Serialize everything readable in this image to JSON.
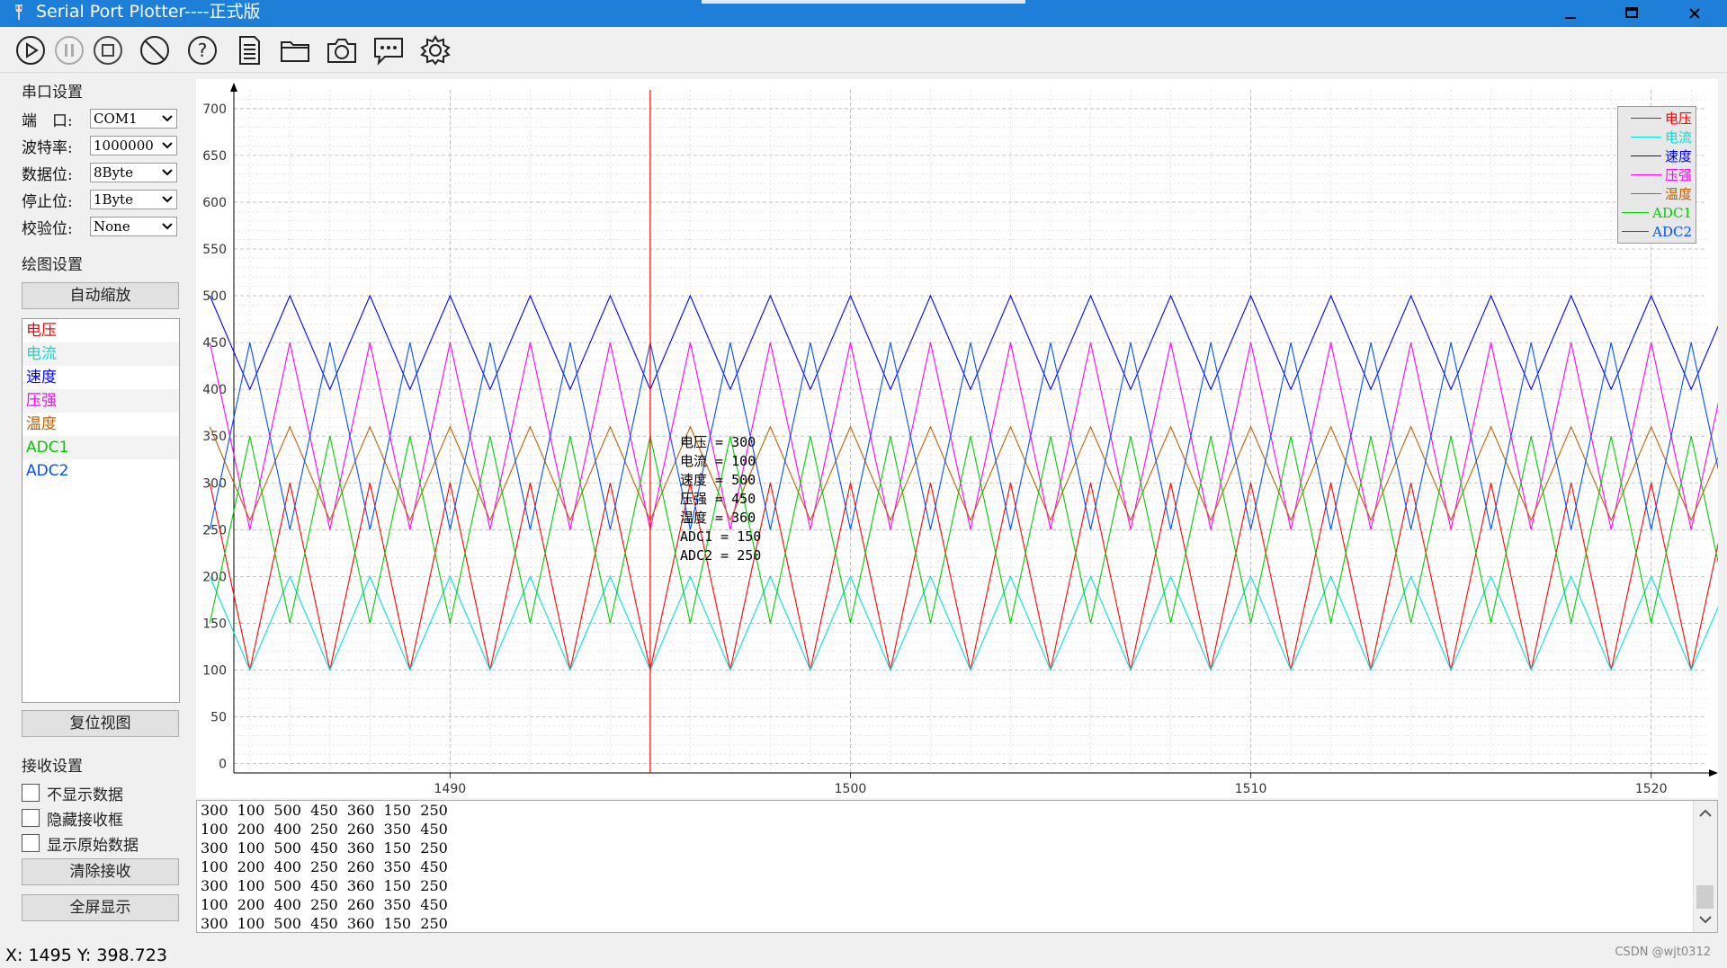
{
  "window": {
    "title": "Serial Port Plotter----正式版",
    "min_label": "—",
    "max_label": "□",
    "close_label": "✕"
  },
  "toolbar": [
    {
      "name": "start-button",
      "icon": "play-icon"
    },
    {
      "name": "pause-button",
      "icon": "pause-icon"
    },
    {
      "name": "stop-button",
      "icon": "stop-icon"
    },
    {
      "name": "clear-button",
      "icon": "no-symbol-icon"
    },
    {
      "name": "help-button",
      "icon": "help-icon"
    },
    {
      "name": "log-button",
      "icon": "document-icon"
    },
    {
      "name": "open-folder-button",
      "icon": "folder-icon"
    },
    {
      "name": "screenshot-button",
      "icon": "camera-icon"
    },
    {
      "name": "message-button",
      "icon": "chat-icon"
    },
    {
      "name": "settings-button",
      "icon": "gear-icon"
    }
  ],
  "serial": {
    "group_title": "串口设置",
    "port_label": "端　口:",
    "port_value": "COM1",
    "baud_label": "波特率:",
    "baud_value": "1000000",
    "databits_label": "数据位:",
    "databits_value": "8Byte",
    "stopbits_label": "停止位:",
    "stopbits_value": "1Byte",
    "parity_label": "校验位:",
    "parity_value": "None"
  },
  "plot_settings": {
    "group_title": "绘图设置",
    "auto_scale_label": "自动缩放",
    "reset_view_label": "复位视图",
    "channels": [
      {
        "label": "电压",
        "color": "#ff0000"
      },
      {
        "label": "电流",
        "color": "#00e0e0"
      },
      {
        "label": "速度",
        "color": "#0000ff"
      },
      {
        "label": "压强",
        "color": "#ff00ff"
      },
      {
        "label": "温度",
        "color": "#c06000"
      },
      {
        "label": "ADC1",
        "color": "#00cc00"
      },
      {
        "label": "ADC2",
        "color": "#0050ff"
      }
    ]
  },
  "receive": {
    "group_title": "接收设置",
    "hide_data_label": "不显示数据",
    "hide_box_label": "隐藏接收框",
    "raw_data_label": "显示原始数据",
    "clear_label": "清除接收",
    "fullscreen_label": "全屏显示",
    "lines": [
      "300  100  500  450  360  150  250",
      "100  200  400  250  260  350  450",
      "300  100  500  450  360  150  250",
      "100  200  400  250  260  350  450",
      "300  100  500  450  360  150  250",
      "100  200  400  250  260  350  450",
      "300  100  500  450  360  150  250"
    ]
  },
  "tracer_text": [
    "电压 = 300",
    "电流 = 100",
    "速度 = 500",
    "压强 = 450",
    "温度 = 360",
    "ADC1 = 150",
    "ADC2 = 250"
  ],
  "status": {
    "cursor": "X: 1495 Y: 398.723",
    "watermark": "CSDN @wjt0312"
  },
  "chart_data": {
    "type": "line",
    "title": "",
    "xlabel": "",
    "ylabel": "",
    "xlim": [
      1484.6,
      1521.4
    ],
    "ylim": [
      -10,
      720
    ],
    "x_ticks": [
      1490,
      1500,
      1510,
      1520
    ],
    "y_ticks": [
      0,
      50,
      100,
      150,
      200,
      250,
      300,
      350,
      400,
      450,
      500,
      550,
      600,
      650,
      700
    ],
    "grid": true,
    "legend_position": "top-right",
    "cursor_x": 1495,
    "series": [
      {
        "name": "电压",
        "color": "#ff0000",
        "period": 2,
        "start_x": 1484,
        "values": [
          300,
          100
        ],
        "start_phase": 0
      },
      {
        "name": "电流",
        "color": "#00e0e0",
        "period": 2,
        "start_x": 1484,
        "values": [
          200,
          100
        ],
        "start_phase": 0
      },
      {
        "name": "速度",
        "color": "#0000ff",
        "period": 2,
        "start_x": 1484,
        "values": [
          500,
          400
        ],
        "start_phase": 0
      },
      {
        "name": "压强",
        "color": "#ff00ff",
        "period": 2,
        "start_x": 1484,
        "values": [
          450,
          250
        ],
        "start_phase": 0
      },
      {
        "name": "温度",
        "color": "#c06000",
        "period": 2,
        "start_x": 1484,
        "values": [
          360,
          260
        ],
        "start_phase": 0
      },
      {
        "name": "ADC1",
        "color": "#00cc00",
        "period": 2,
        "start_x": 1484,
        "values": [
          150,
          350
        ],
        "start_phase": 0
      },
      {
        "name": "ADC2",
        "color": "#0050ff",
        "period": 2,
        "start_x": 1484,
        "values": [
          250,
          450
        ],
        "start_phase": 0
      }
    ]
  }
}
